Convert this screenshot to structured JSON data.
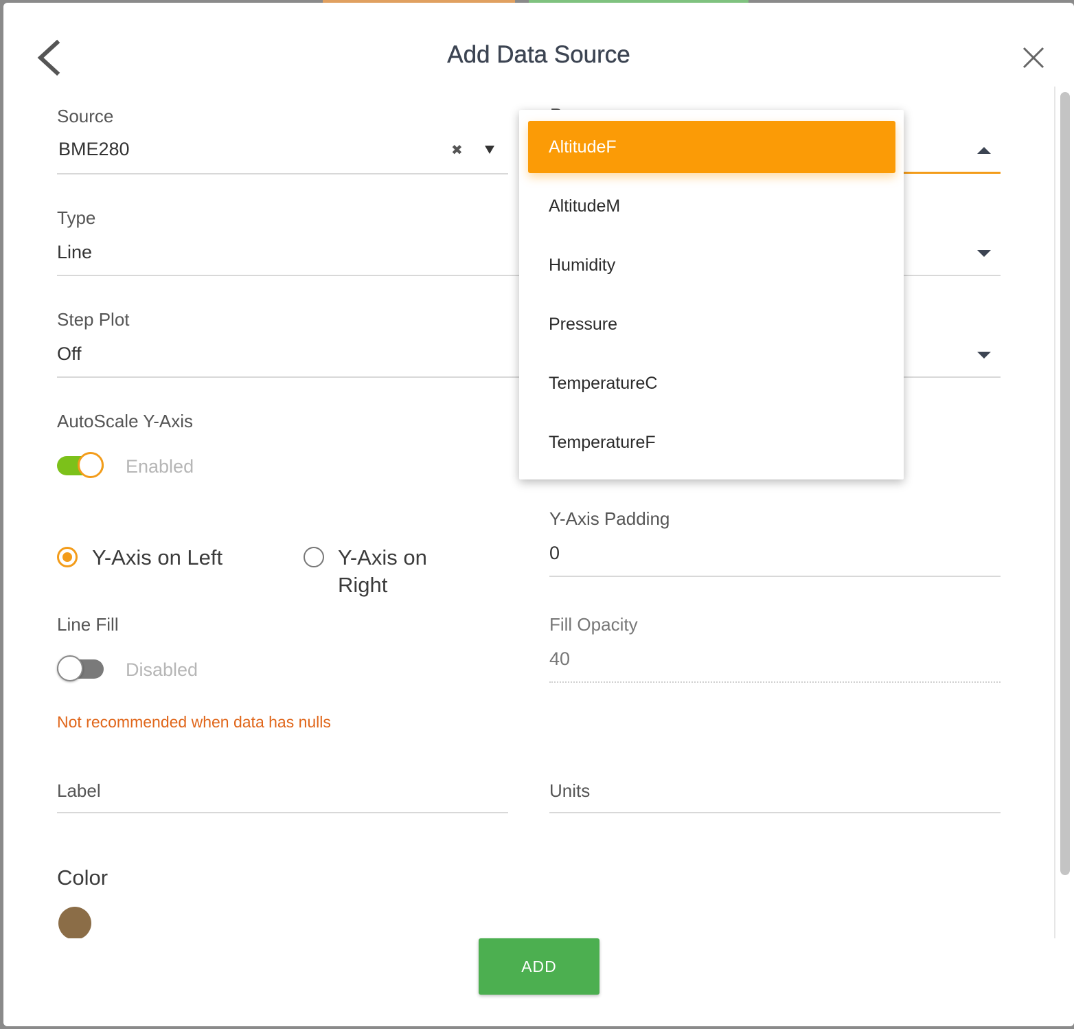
{
  "dialog": {
    "title": "Add Data Source"
  },
  "form": {
    "source": {
      "label": "Source",
      "value": "BME280",
      "clear_glyph": "✖"
    },
    "property": {
      "label_partial": "P",
      "state": "open"
    },
    "type": {
      "label": "Type",
      "value": "Line"
    },
    "step_plot": {
      "label": "Step Plot",
      "value": "Off"
    },
    "autoscale": {
      "label": "AutoScale Y-Axis",
      "state_text": "Enabled",
      "on": true
    },
    "y_axis_position": {
      "left_label": "Y-Axis on Left",
      "right_label_line1": "Y-Axis on",
      "right_label_line2": "Right",
      "selected": "left"
    },
    "y_axis_padding": {
      "label": "Y-Axis Padding",
      "value": "0"
    },
    "line_fill": {
      "label": "Line Fill",
      "state_text": "Disabled",
      "on": false
    },
    "fill_opacity": {
      "label": "Fill Opacity",
      "value": "40"
    },
    "warning": "Not recommended when data has nulls",
    "label_field": {
      "placeholder": "Label"
    },
    "units_field": {
      "placeholder": "Units"
    },
    "color": {
      "label": "Color",
      "value": "#8b6d47"
    }
  },
  "dropdown": {
    "options": [
      "AltitudeF",
      "AltitudeM",
      "Humidity",
      "Pressure",
      "TemperatureC",
      "TemperatureF"
    ],
    "selected": "AltitudeF"
  },
  "buttons": {
    "add": "ADD"
  },
  "colors": {
    "accent": "#f39c1a",
    "selected_option": "#fb9b06",
    "toggle_on": "#7cc11a",
    "add_button": "#4caf50",
    "warning": "#e0661a"
  },
  "icons": {
    "back": "chevron-left-icon",
    "close": "close-icon",
    "dropdown_closed": "caret-down-icon",
    "dropdown_open": "caret-up-icon"
  }
}
